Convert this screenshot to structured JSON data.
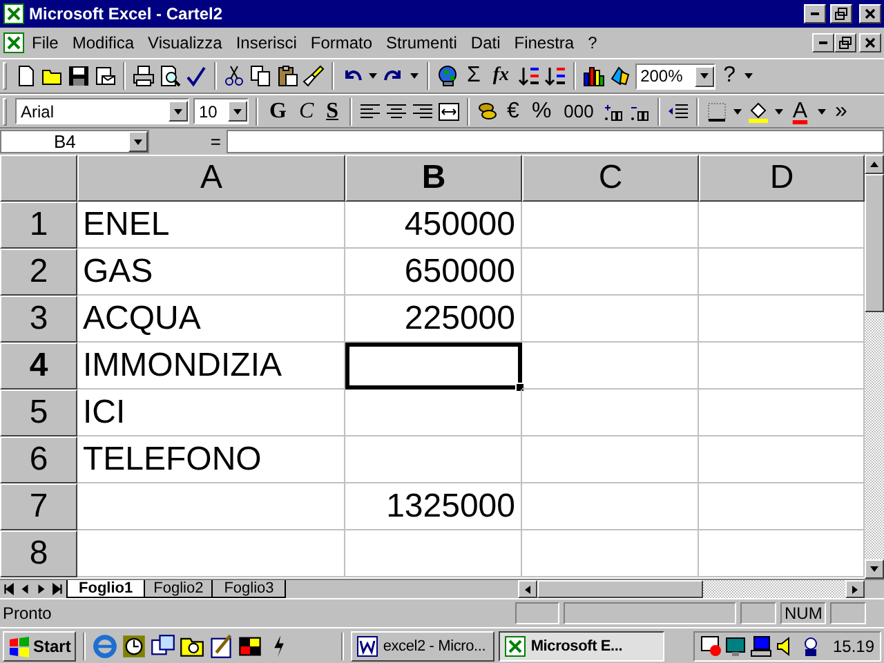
{
  "window": {
    "title": "Microsoft Excel - Cartel2"
  },
  "menu": [
    {
      "label": "File"
    },
    {
      "label": "Modifica"
    },
    {
      "label": "Visualizza"
    },
    {
      "label": "Inserisci"
    },
    {
      "label": "Formato"
    },
    {
      "label": "Strumenti"
    },
    {
      "label": "Dati"
    },
    {
      "label": "Finestra"
    },
    {
      "label": "?"
    }
  ],
  "standard_toolbar": {
    "sum": "Σ",
    "function": "fx",
    "zoom": "200%",
    "help": "?"
  },
  "format_toolbar": {
    "font": "Arial",
    "size": "10",
    "bold": "G",
    "italic": "C",
    "underline": "S",
    "euro": "€",
    "percent": "%",
    "thousands": "000",
    "font_color": "A",
    "more": "»"
  },
  "formula_bar": {
    "name_box": "B4",
    "equals": "="
  },
  "sheet": {
    "columns": [
      {
        "label": "A",
        "selected": false,
        "kind": "text"
      },
      {
        "label": "B",
        "selected": true,
        "kind": "number"
      },
      {
        "label": "C",
        "selected": false
      },
      {
        "label": "D",
        "selected": false
      }
    ],
    "rows": [
      {
        "header": "1",
        "selected": false,
        "a": "ENEL",
        "b": "450000"
      },
      {
        "header": "2",
        "selected": false,
        "a": "GAS",
        "b": "650000"
      },
      {
        "header": "3",
        "selected": false,
        "a": "ACQUA",
        "b": "225000"
      },
      {
        "header": "4",
        "selected": true,
        "a": "IMMONDIZIA"
      },
      {
        "header": "5",
        "selected": false,
        "a": "ICI"
      },
      {
        "header": "6",
        "selected": false,
        "a": "TELEFONO"
      },
      {
        "header": "7",
        "selected": false,
        "b": "1325000"
      },
      {
        "header": "8",
        "selected": false
      }
    ]
  },
  "sheet_tabs": [
    {
      "label": "Foglio1",
      "selected": true
    },
    {
      "label": "Foglio2",
      "selected": false
    },
    {
      "label": "Foglio3",
      "selected": false
    }
  ],
  "status_bar": {
    "text": "Pronto",
    "indicator": "NUM"
  },
  "taskbar": {
    "start": "Start",
    "tasks": [
      {
        "label": "excel2 - Micro...",
        "selected": false,
        "kind": "word"
      },
      {
        "label": "Microsoft E...",
        "selected": true,
        "kind": "excel"
      }
    ],
    "clock": "15.19"
  }
}
